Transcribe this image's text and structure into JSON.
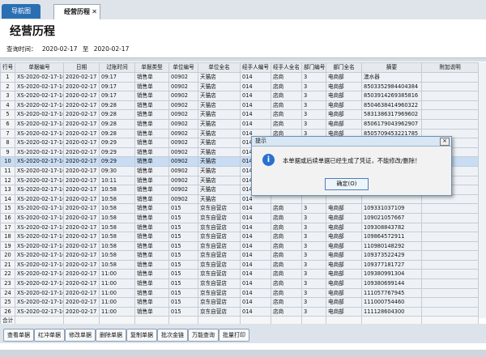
{
  "tabs": {
    "nav_label": "导航图",
    "history_label": "经营历程",
    "close_glyph": "✕"
  },
  "page": {
    "title": "经营历程"
  },
  "query": {
    "label": "查询时间：",
    "from": "2020-02-17",
    "to_label": "至",
    "to": "2020-02-17"
  },
  "grid": {
    "headers": [
      "行号",
      "单据编号",
      "日期",
      "过账时间",
      "单据类型",
      "单位编号",
      "单位全名",
      "经手人编号",
      "经手人全名",
      "部门编号",
      "部门全名",
      "摘要",
      "附加说明"
    ],
    "rows": [
      [
        "1",
        "XS-2020-02-17-1(",
        "2020-02-17",
        "09:17",
        "销售单",
        "00902",
        "天猫店",
        "014",
        "店商",
        "3",
        "电商部",
        "澳水器",
        ""
      ],
      [
        "2",
        "XS-2020-02-17-1(",
        "2020-02-17",
        "09:17",
        "销售单",
        "00902",
        "天猫店",
        "014",
        "店商",
        "3",
        "电商部",
        "8503352984404384",
        ""
      ],
      [
        "3",
        "XS-2020-02-17-1(",
        "2020-02-17",
        "09:17",
        "销售单",
        "00902",
        "天猫店",
        "014",
        "店商",
        "3",
        "电商部",
        "8503914269385816",
        ""
      ],
      [
        "4",
        "XS-2020-02-17-1(",
        "2020-02-17",
        "09:28",
        "销售单",
        "00902",
        "天猫店",
        "014",
        "店商",
        "3",
        "电商部",
        "8504638414960322",
        ""
      ],
      [
        "5",
        "XS-2020-02-17-1(",
        "2020-02-17",
        "09:28",
        "销售单",
        "00902",
        "天猫店",
        "014",
        "店商",
        "3",
        "电商部",
        "5831386317969602",
        ""
      ],
      [
        "6",
        "XS-2020-02-17-1(",
        "2020-02-17",
        "09:28",
        "销售单",
        "00902",
        "天猫店",
        "014",
        "店商",
        "3",
        "电商部",
        "8506179043962907",
        ""
      ],
      [
        "7",
        "XS-2020-02-17-1(",
        "2020-02-17",
        "09:28",
        "销售单",
        "00902",
        "天猫店",
        "014",
        "店商",
        "3",
        "电商部",
        "8505709453221785",
        ""
      ],
      [
        "8",
        "XS-2020-02-17-1(",
        "2020-02-17",
        "09:29",
        "销售单",
        "00902",
        "天猫店",
        "014",
        "",
        "",
        "",
        "",
        ""
      ],
      [
        "9",
        "XS-2020-02-17-1(",
        "2020-02-17",
        "09:29",
        "销售单",
        "00902",
        "天猫店",
        "014",
        "",
        "",
        "",
        "",
        ""
      ],
      [
        "10",
        "XS-2020-02-17-1(",
        "2020-02-17",
        "09:29",
        "销售单",
        "00902",
        "天猫店",
        "014",
        "",
        "",
        "",
        "",
        ""
      ],
      [
        "11",
        "XS-2020-02-17-1(",
        "2020-02-17",
        "09:30",
        "销售单",
        "00902",
        "天猫店",
        "014",
        "",
        "",
        "",
        "",
        ""
      ],
      [
        "12",
        "XS-2020-02-17-1(",
        "2020-02-17",
        "10:11",
        "销售单",
        "00902",
        "天猫店",
        "014",
        "",
        "",
        "",
        "",
        ""
      ],
      [
        "13",
        "XS-2020-02-17-1(",
        "2020-02-17",
        "10:58",
        "销售单",
        "00902",
        "天猫店",
        "014",
        "",
        "",
        "",
        "",
        ""
      ],
      [
        "14",
        "XS-2020-02-17-1(",
        "2020-02-17",
        "10:58",
        "销售单",
        "00902",
        "天猫店",
        "014",
        "",
        "",
        "",
        "",
        ""
      ],
      [
        "15",
        "XS-2020-02-17-1(",
        "2020-02-17",
        "10:58",
        "销售单",
        "015",
        "京东自营店",
        "014",
        "店商",
        "3",
        "电商部",
        "109331037109",
        ""
      ],
      [
        "16",
        "XS-2020-02-17-1(",
        "2020-02-17",
        "10:58",
        "销售单",
        "015",
        "京东自营店",
        "014",
        "店商",
        "3",
        "电商部",
        "109021057667",
        ""
      ],
      [
        "17",
        "XS-2020-02-17-1(",
        "2020-02-17",
        "10:58",
        "销售单",
        "015",
        "京东自营店",
        "014",
        "店商",
        "3",
        "电商部",
        "109308843782",
        ""
      ],
      [
        "18",
        "XS-2020-02-17-1(",
        "2020-02-17",
        "10:58",
        "销售单",
        "015",
        "京东自营店",
        "014",
        "店商",
        "3",
        "电商部",
        "109864572911",
        ""
      ],
      [
        "19",
        "XS-2020-02-17-1(",
        "2020-02-17",
        "10:58",
        "销售单",
        "015",
        "京东自营店",
        "014",
        "店商",
        "3",
        "电商部",
        "110980148292",
        ""
      ],
      [
        "20",
        "XS-2020-02-17-1(",
        "2020-02-17",
        "10:58",
        "销售单",
        "015",
        "京东自营店",
        "014",
        "店商",
        "3",
        "电商部",
        "109373522429",
        ""
      ],
      [
        "21",
        "XS-2020-02-17-1(",
        "2020-02-17",
        "10:58",
        "销售单",
        "015",
        "京东自营店",
        "014",
        "店商",
        "3",
        "电商部",
        "109377181727",
        ""
      ],
      [
        "22",
        "XS-2020-02-17-1(",
        "2020-02-17",
        "11:00",
        "销售单",
        "015",
        "京东自营店",
        "014",
        "店商",
        "3",
        "电商部",
        "109380991304",
        ""
      ],
      [
        "23",
        "XS-2020-02-17-1(",
        "2020-02-17",
        "11:00",
        "销售单",
        "015",
        "京东自营店",
        "014",
        "店商",
        "3",
        "电商部",
        "109380699144",
        ""
      ],
      [
        "24",
        "XS-2020-02-17-1(",
        "2020-02-17",
        "11:00",
        "销售单",
        "015",
        "京东自营店",
        "014",
        "店商",
        "3",
        "电商部",
        "111057767945",
        ""
      ],
      [
        "25",
        "XS-2020-02-17-1(",
        "2020-02-17",
        "11:00",
        "销售单",
        "015",
        "京东自营店",
        "014",
        "店商",
        "3",
        "电商部",
        "111000754460",
        ""
      ],
      [
        "26",
        "XS-2020-02-17-1(",
        "2020-02-17",
        "11:00",
        "销售单",
        "015",
        "京东自营店",
        "014",
        "店商",
        "3",
        "电商部",
        "111128604300",
        ""
      ]
    ],
    "total_label": "合计"
  },
  "toolbar": {
    "buttons": [
      "查看单据",
      "红冲单据",
      "修改单据",
      "删除单据",
      "复制单据",
      "批次金链",
      "万能查询",
      "批量打印"
    ]
  },
  "dialog": {
    "title": "提示",
    "icon_glyph": "i",
    "message": "本单据或后续单据已经生成了凭证，不能修改/删除！",
    "ok_label": "确定(O)"
  },
  "colors": {
    "tab_active": "#2b6fb3",
    "selected_row": "#c8dcf3",
    "dialog_icon": "#2a6fd1"
  }
}
